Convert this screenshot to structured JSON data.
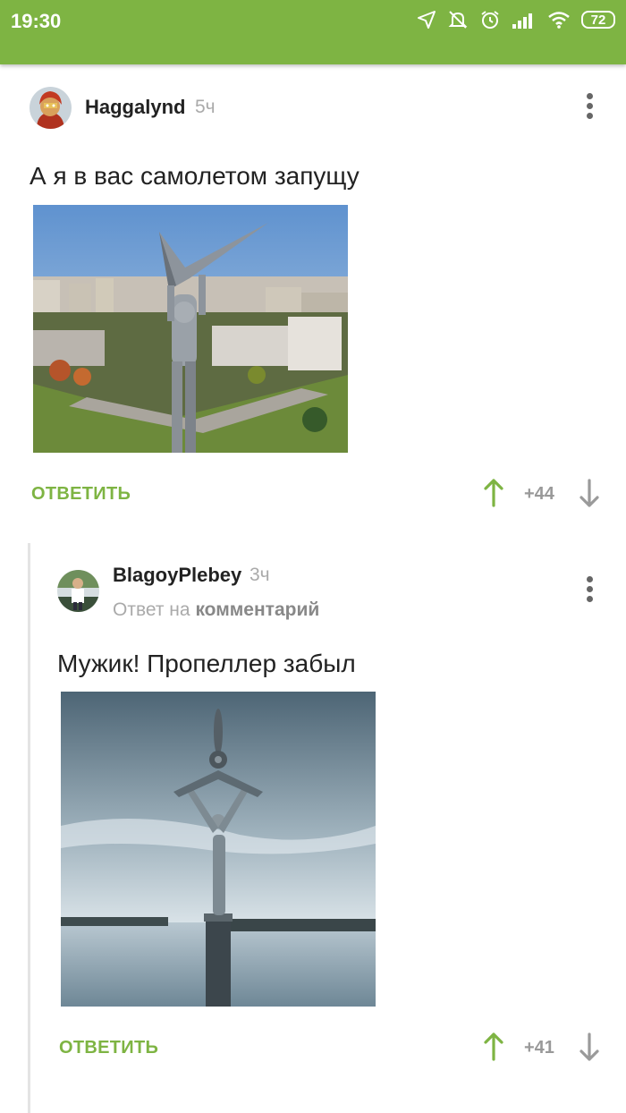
{
  "status": {
    "time": "19:30",
    "battery": "72",
    "icons": [
      "location-icon",
      "silent-icon",
      "alarm-icon",
      "signal-icon",
      "wifi-icon",
      "battery-icon"
    ]
  },
  "comments": [
    {
      "username": "Haggalynd",
      "time_ago": "5ч",
      "text": "А я в вас самолетом запущу",
      "reply_label": "ОТВЕТИТЬ",
      "rating": "+44"
    },
    {
      "username": "BlagoyPlebey",
      "time_ago": "3ч",
      "reply_to_prefix": "Ответ на",
      "reply_to_link": "комментарий",
      "text": "Мужик! Пропеллер забыл",
      "reply_label": "ОТВЕТИТЬ",
      "rating": "+41"
    }
  ],
  "colors": {
    "accent": "#7eb443",
    "text": "#222222",
    "muted": "#aaaaaa"
  }
}
